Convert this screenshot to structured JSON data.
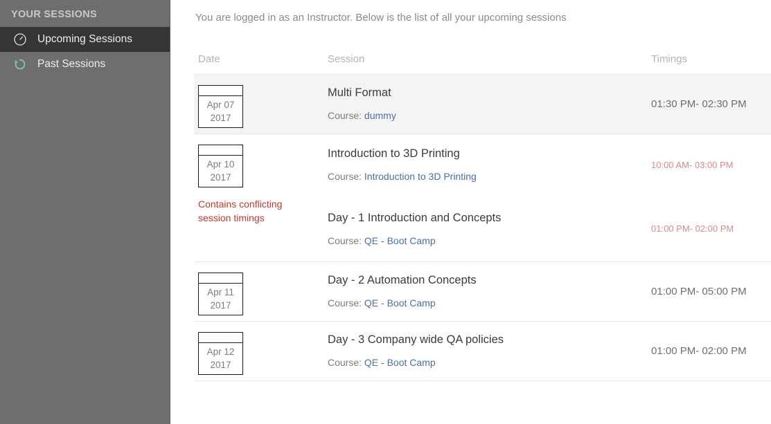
{
  "sidebar": {
    "title": "YOUR SESSIONS",
    "items": [
      {
        "label": "Upcoming Sessions",
        "icon": "clock-icon",
        "active": true
      },
      {
        "label": "Past Sessions",
        "icon": "history-refresh-icon",
        "active": false
      }
    ]
  },
  "main": {
    "intro": "You are logged in as an Instructor. Below is the list of all your upcoming sessions",
    "table": {
      "headers": {
        "date": "Date",
        "session": "Session",
        "timings": "Timings"
      },
      "course_label": "Course:",
      "conflict_note": "Contains conflicting session timings",
      "rows": [
        {
          "date_month_day": "Apr 07",
          "date_year": "2017",
          "title": "Multi Format",
          "course": "dummy",
          "timings": "01:30 PM- 02:30 PM",
          "highlight": true,
          "conflict": false
        },
        {
          "date_month_day": "Apr 10",
          "date_year": "2017",
          "conflict": true,
          "sessions": [
            {
              "title": "Introduction to 3D Printing",
              "course": "Introduction to 3D Printing",
              "timings": "10:00 AM- 03:00 PM"
            },
            {
              "title": "Day - 1 Introduction and Concepts",
              "course": "QE - Boot Camp",
              "timings": "01:00 PM- 02:00 PM"
            }
          ]
        },
        {
          "date_month_day": "Apr 11",
          "date_year": "2017",
          "title": "Day - 2 Automation Concepts",
          "course": "QE - Boot Camp",
          "timings": "01:00 PM- 05:00 PM",
          "highlight": false,
          "conflict": false
        },
        {
          "date_month_day": "Apr 12",
          "date_year": "2017",
          "title": "Day - 3 Company wide QA policies",
          "course": "QE - Boot Camp",
          "timings": "01:00 PM- 02:00 PM",
          "highlight": false,
          "conflict": false
        }
      ]
    }
  },
  "colors": {
    "sidebar_bg": "#6e6e6e",
    "sidebar_active_bg": "#353535",
    "link": "#4a6fa5",
    "conflict_text": "#c0392b",
    "conflict_time": "#d98a8a",
    "row_highlight": "#f4f4f4",
    "past_icon_teal": "#79bdb8"
  }
}
